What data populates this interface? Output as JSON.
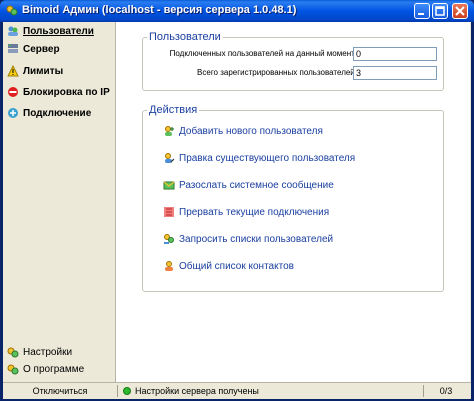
{
  "window": {
    "title": "Bimoid Админ (localhost - версия сервера 1.0.48.1)"
  },
  "sidebar": {
    "items": [
      {
        "label": "Пользователи",
        "icon": "users-icon"
      },
      {
        "label": "Сервер",
        "icon": "server-icon"
      },
      {
        "label": "Лимиты",
        "icon": "warning-icon"
      },
      {
        "label": "Блокировка по IP",
        "icon": "block-icon"
      },
      {
        "label": "Подключение",
        "icon": "connection-icon"
      }
    ],
    "bottom": [
      {
        "label": "Настройки",
        "icon": "settings-icon"
      },
      {
        "label": "О программе",
        "icon": "info-icon"
      }
    ]
  },
  "users_group": {
    "title": "Пользователи",
    "online_label": "Подключенных пользователей на данный момент:",
    "online_value": "0",
    "total_label": "Всего зарегистрированных пользователей:",
    "total_value": "3"
  },
  "actions_group": {
    "title": "Действия",
    "items": [
      {
        "label": "Добавить нового пользователя",
        "icon": "add-user-icon"
      },
      {
        "label": "Правка существующего пользователя",
        "icon": "edit-user-icon"
      },
      {
        "label": "Разослать системное сообщение",
        "icon": "message-icon"
      },
      {
        "label": "Прервать текущие подключения",
        "icon": "disconnect-icon"
      },
      {
        "label": "Запросить списки пользователей",
        "icon": "request-list-icon"
      },
      {
        "label": "Общий список контактов",
        "icon": "contacts-icon"
      }
    ]
  },
  "statusbar": {
    "disconnect": "Отключиться",
    "status": "Настройки сервера получены",
    "count": "0/3"
  },
  "colors": {
    "titlebar": "#0054e3",
    "link": "#1a3fa0",
    "status_ok": "#2bb82b"
  }
}
